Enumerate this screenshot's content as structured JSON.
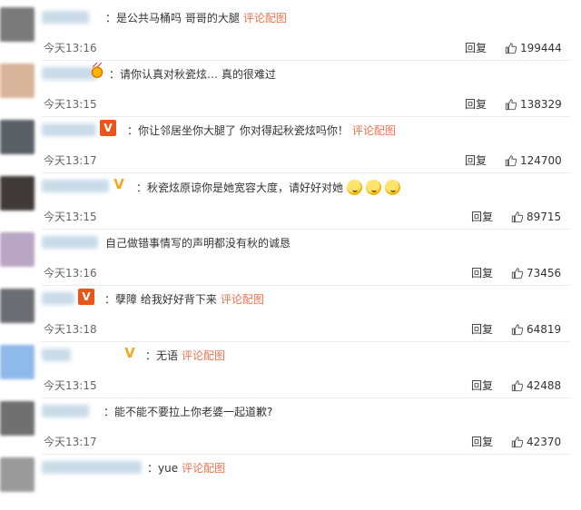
{
  "comments": [
    {
      "text": "：是公共马桶吗 哥哥的大腿",
      "link": "评论配图",
      "time": "今天13:16",
      "reply": "回复",
      "likes": "199444",
      "avatar_color": "#7a7a7a",
      "badge": ""
    },
    {
      "text": "：请你认真对秋瓷炫… 真的很难过",
      "link": "",
      "time": "今天13:15",
      "reply": "回复",
      "likes": "138329",
      "avatar_color": "#d8b49a",
      "badge": "crown"
    },
    {
      "text": "：你让邻居坐你大腿了 你对得起秋瓷炫吗你！",
      "link": "评论配图",
      "time": "今天13:17",
      "reply": "回复",
      "likes": "124700",
      "avatar_color": "#5a5f66",
      "badge": "v-red"
    },
    {
      "text": "：秋瓷炫原谅你是她宽容大度，请好好对她",
      "link": "",
      "emoji_count": 3,
      "time": "今天13:15",
      "reply": "回复",
      "likes": "89715",
      "avatar_color": "#3f3a38",
      "badge": "v-yellow"
    },
    {
      "text": "自己做错事情写的声明都没有秋的诚恳",
      "link": "",
      "time": "今天13:16",
      "reply": "回复",
      "likes": "73456",
      "avatar_color": "#b9a5c4",
      "badge": ""
    },
    {
      "text": "：孽障 给我好好背下来",
      "link": "评论配图",
      "time": "今天13:18",
      "reply": "回复",
      "likes": "64819",
      "avatar_color": "#6b6e73",
      "badge": "v-red"
    },
    {
      "text": "：无语",
      "link": "评论配图",
      "time": "今天13:15",
      "reply": "回复",
      "likes": "42488",
      "avatar_color": "#8fb9ea",
      "badge": "v-yellow"
    },
    {
      "text": "：能不能不要拉上你老婆一起道歉?",
      "link": "",
      "time": "今天13:17",
      "reply": "回复",
      "likes": "42370",
      "avatar_color": "#707070",
      "badge": ""
    },
    {
      "text": "：yue",
      "link": "评论配图",
      "time": "",
      "reply": "",
      "likes": "",
      "avatar_color": "#9a9a9a",
      "badge": ""
    }
  ]
}
